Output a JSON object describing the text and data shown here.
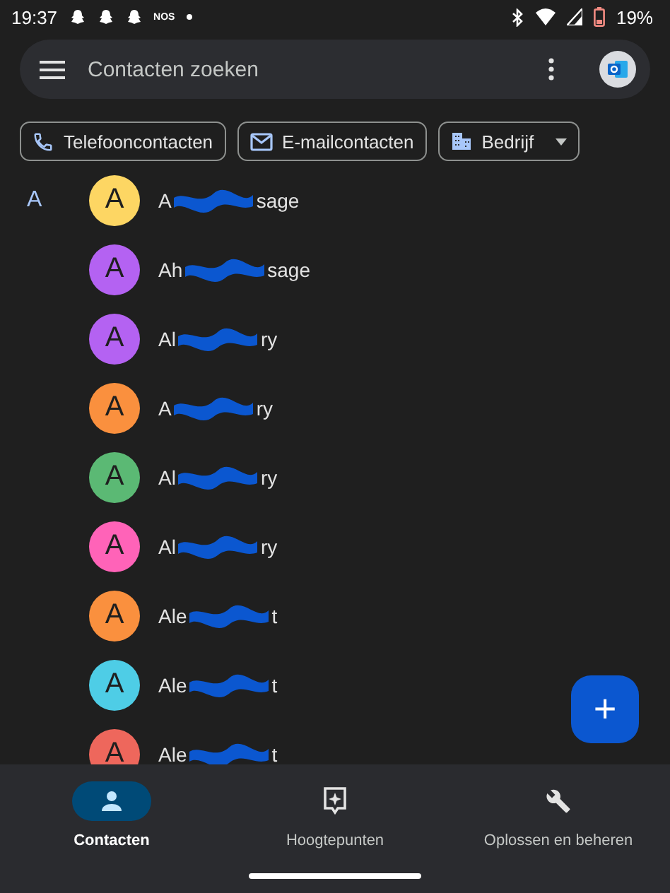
{
  "status_bar": {
    "time": "19:37",
    "notification_text": "NOS",
    "battery": "19%"
  },
  "search": {
    "placeholder": "Contacten zoeken"
  },
  "filters": [
    {
      "kind": "phone",
      "label": "Telefooncontacten"
    },
    {
      "kind": "email",
      "label": "E-mailcontacten"
    },
    {
      "kind": "company",
      "label": "Bedrijf"
    }
  ],
  "section": "A",
  "contacts": [
    {
      "initial": "A",
      "color": "#fdd663",
      "name_start": "A",
      "name_end": "sage"
    },
    {
      "initial": "A",
      "color": "#b462f2",
      "name_start": "Ah",
      "name_end": "sage"
    },
    {
      "initial": "A",
      "color": "#b462f2",
      "name_start": "Al",
      "name_end": "ry"
    },
    {
      "initial": "A",
      "color": "#fa903e",
      "name_start": "A",
      "name_end": "ry"
    },
    {
      "initial": "A",
      "color": "#5bb974",
      "name_start": "Al",
      "name_end": "ry"
    },
    {
      "initial": "A",
      "color": "#ff63b8",
      "name_start": "Al",
      "name_end": "ry"
    },
    {
      "initial": "A",
      "color": "#fa903e",
      "name_start": "Ale",
      "name_end": "t"
    },
    {
      "initial": "A",
      "color": "#4ecde6",
      "name_start": "Ale",
      "name_end": "t"
    },
    {
      "initial": "A",
      "color": "#ee675c",
      "name_start": "Ale",
      "name_end": "t"
    }
  ],
  "fab": "+",
  "nav": [
    {
      "kind": "person",
      "label": "Contacten",
      "selected": true
    },
    {
      "kind": "highlight",
      "label": "Hoogtepunten",
      "selected": false
    },
    {
      "kind": "wrench",
      "label": "Oplossen en beheren",
      "selected": false
    }
  ]
}
